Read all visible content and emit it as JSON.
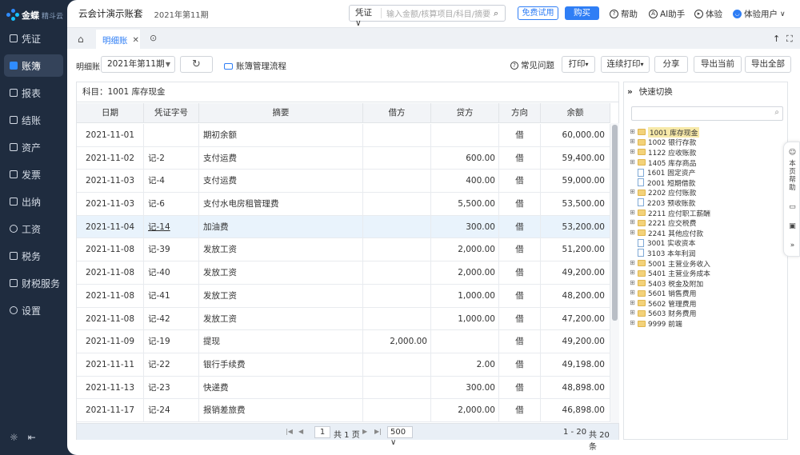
{
  "brand": {
    "name": "金蝶",
    "sub": "精斗云"
  },
  "sidebar": {
    "items": [
      {
        "label": "凭证"
      },
      {
        "label": "账簿"
      },
      {
        "label": "报表"
      },
      {
        "label": "结账"
      },
      {
        "label": "资产"
      },
      {
        "label": "发票"
      },
      {
        "label": "出纳"
      },
      {
        "label": "工资"
      },
      {
        "label": "税务"
      },
      {
        "label": "财税服务"
      },
      {
        "label": "设置"
      }
    ],
    "active_index": 1
  },
  "header": {
    "app_title": "云会计演示账套",
    "period": "2021年第11期",
    "search_type": "凭证",
    "search_placeholder": "输入金额/核算项目/科目/摘要",
    "trial_label": "免费试用",
    "buy_label": "购买",
    "help_label": "帮助",
    "ai_label": "AI助手",
    "experience_label": "体验",
    "user_label": "体验用户"
  },
  "tabs": [
    {
      "label": "明细账"
    }
  ],
  "toolbar": {
    "ledger_label": "明细账",
    "period_value": "2021年第11期",
    "flow_label": "账簿管理流程",
    "faq_label": "常见问题",
    "print_label": "打印",
    "batch_print_label": "连续打印",
    "share_label": "分享",
    "export_current_label": "导出当前",
    "export_all_label": "导出全部"
  },
  "grid": {
    "subject": "科目：1001 库存现金",
    "columns": [
      "日期",
      "凭证字号",
      "摘要",
      "借方",
      "贷方",
      "方向",
      "余额"
    ],
    "rows": [
      {
        "date": "2021-11-01",
        "voucher": "",
        "summary": "期初余额",
        "debit": "",
        "credit": "",
        "dir": "借",
        "balance": "60,000.00"
      },
      {
        "date": "2021-11-02",
        "voucher": "记-2",
        "summary": "支付运费",
        "debit": "",
        "credit": "600.00",
        "dir": "借",
        "balance": "59,400.00"
      },
      {
        "date": "2021-11-03",
        "voucher": "记-4",
        "summary": "支付运费",
        "debit": "",
        "credit": "400.00",
        "dir": "借",
        "balance": "59,000.00"
      },
      {
        "date": "2021-11-03",
        "voucher": "记-6",
        "summary": "支付水电房租管理费",
        "debit": "",
        "credit": "5,500.00",
        "dir": "借",
        "balance": "53,500.00"
      },
      {
        "date": "2021-11-04",
        "voucher": "记-14",
        "summary": "加油费",
        "debit": "",
        "credit": "300.00",
        "dir": "借",
        "balance": "53,200.00"
      },
      {
        "date": "2021-11-08",
        "voucher": "记-39",
        "summary": "发放工资",
        "debit": "",
        "credit": "2,000.00",
        "dir": "借",
        "balance": "51,200.00"
      },
      {
        "date": "2021-11-08",
        "voucher": "记-40",
        "summary": "发放工资",
        "debit": "",
        "credit": "2,000.00",
        "dir": "借",
        "balance": "49,200.00"
      },
      {
        "date": "2021-11-08",
        "voucher": "记-41",
        "summary": "发放工资",
        "debit": "",
        "credit": "1,000.00",
        "dir": "借",
        "balance": "48,200.00"
      },
      {
        "date": "2021-11-08",
        "voucher": "记-42",
        "summary": "发放工资",
        "debit": "",
        "credit": "1,000.00",
        "dir": "借",
        "balance": "47,200.00"
      },
      {
        "date": "2021-11-09",
        "voucher": "记-19",
        "summary": "提现",
        "debit": "2,000.00",
        "credit": "",
        "dir": "借",
        "balance": "49,200.00"
      },
      {
        "date": "2021-11-11",
        "voucher": "记-22",
        "summary": "银行手续费",
        "debit": "",
        "credit": "2.00",
        "dir": "借",
        "balance": "49,198.00"
      },
      {
        "date": "2021-11-13",
        "voucher": "记-23",
        "summary": "快递费",
        "debit": "",
        "credit": "300.00",
        "dir": "借",
        "balance": "48,898.00"
      },
      {
        "date": "2021-11-17",
        "voucher": "记-24",
        "summary": "报销差旅费",
        "debit": "",
        "credit": "2,000.00",
        "dir": "借",
        "balance": "46,898.00"
      }
    ],
    "highlight_index": 4
  },
  "pager": {
    "page": "1",
    "total_pages": "共 1 页",
    "page_size": "500",
    "range": "1 - 20",
    "total": "共 20 条"
  },
  "quick": {
    "title": "快速切换",
    "nodes": [
      {
        "label": "1001 库存现金",
        "type": "folder",
        "selected": true
      },
      {
        "label": "1002 银行存款",
        "type": "folder"
      },
      {
        "label": "1122 应收账款",
        "type": "folder"
      },
      {
        "label": "1405 库存商品",
        "type": "folder"
      },
      {
        "label": "1601 固定资产",
        "type": "doc"
      },
      {
        "label": "2001 短期借款",
        "type": "doc"
      },
      {
        "label": "2202 应付账款",
        "type": "folder"
      },
      {
        "label": "2203 预收账款",
        "type": "doc"
      },
      {
        "label": "2211 应付职工薪酬",
        "type": "folder"
      },
      {
        "label": "2221 应交税费",
        "type": "folder"
      },
      {
        "label": "2241 其他应付款",
        "type": "folder"
      },
      {
        "label": "3001 实收资本",
        "type": "doc"
      },
      {
        "label": "3103 本年利润",
        "type": "doc"
      },
      {
        "label": "5001 主营业务收入",
        "type": "folder"
      },
      {
        "label": "5401 主营业务成本",
        "type": "folder"
      },
      {
        "label": "5403 税金及附加",
        "type": "folder"
      },
      {
        "label": "5601 销售费用",
        "type": "folder"
      },
      {
        "label": "5602 管理费用",
        "type": "folder"
      },
      {
        "label": "5603 财务费用",
        "type": "folder"
      },
      {
        "label": "9999 前端",
        "type": "folder"
      }
    ]
  },
  "float_help": {
    "label": "本页帮助"
  },
  "colors": {
    "accent": "#2f7ef5",
    "sidebar_bg": "#1f2c3f",
    "highlight_row": "#e9f3fc"
  }
}
